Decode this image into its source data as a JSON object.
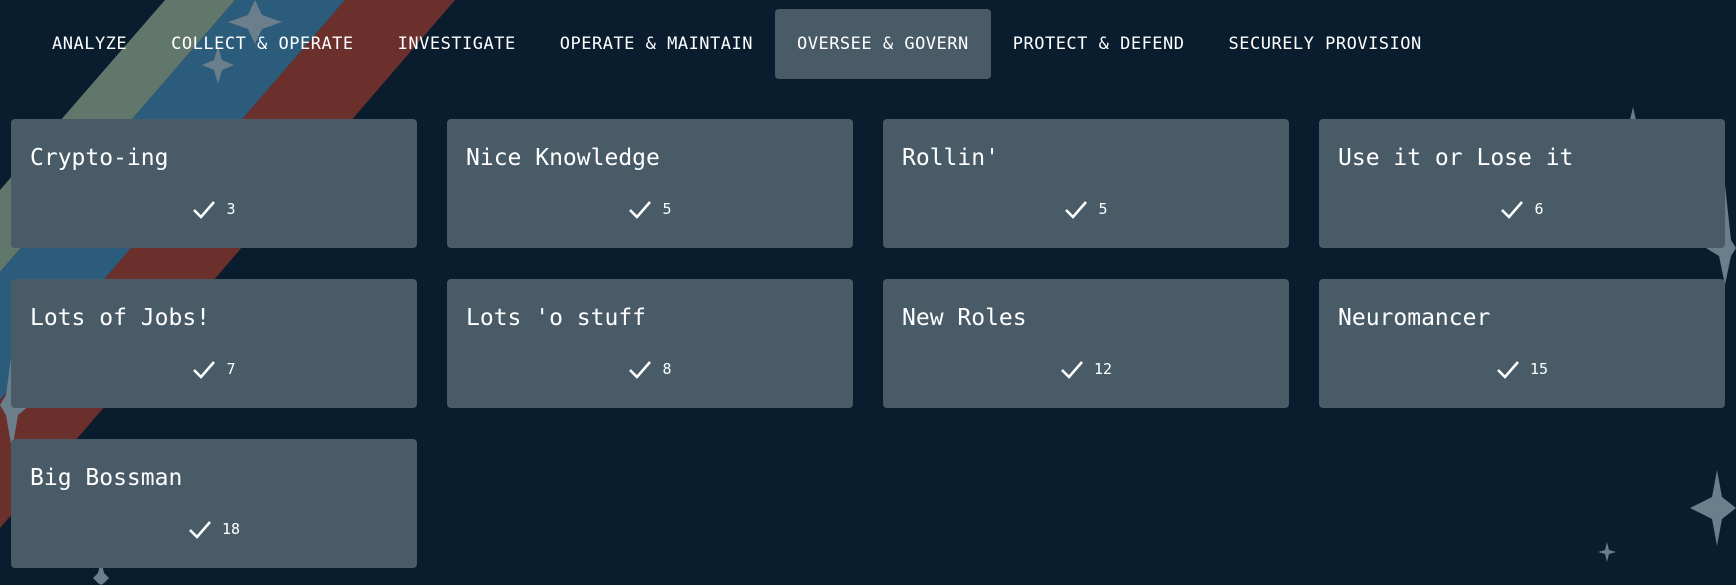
{
  "nav": {
    "tabs": [
      {
        "label": "ANALYZE",
        "active": false
      },
      {
        "label": "COLLECT & OPERATE",
        "active": false
      },
      {
        "label": "INVESTIGATE",
        "active": false
      },
      {
        "label": "OPERATE & MAINTAIN",
        "active": false
      },
      {
        "label": "OVERSEE & GOVERN",
        "active": true
      },
      {
        "label": "PROTECT & DEFEND",
        "active": false
      },
      {
        "label": "SECURELY PROVISION",
        "active": false
      }
    ]
  },
  "cards": [
    {
      "title": "Crypto-ing",
      "count": "3"
    },
    {
      "title": "Nice Knowledge",
      "count": "5"
    },
    {
      "title": "Rollin'",
      "count": "5"
    },
    {
      "title": "Use it or Lose it",
      "count": "6"
    },
    {
      "title": "Lots of Jobs!",
      "count": "7"
    },
    {
      "title": "Lots 'o stuff",
      "count": "8"
    },
    {
      "title": "New Roles",
      "count": "12"
    },
    {
      "title": "Neuromancer",
      "count": "15"
    },
    {
      "title": "Big Bossman",
      "count": "18"
    }
  ],
  "icons": {
    "completed": "check-icon",
    "decoration": "sparkle-star-icon"
  },
  "colors": {
    "background": "#091d2e",
    "card": "#485b67",
    "active_tab": "#485b67",
    "text": "#ffffff",
    "stripe_sage": "#62776c",
    "stripe_blue": "#2c5c7c",
    "stripe_red": "#6b302c",
    "star": "#6b7e8c"
  }
}
